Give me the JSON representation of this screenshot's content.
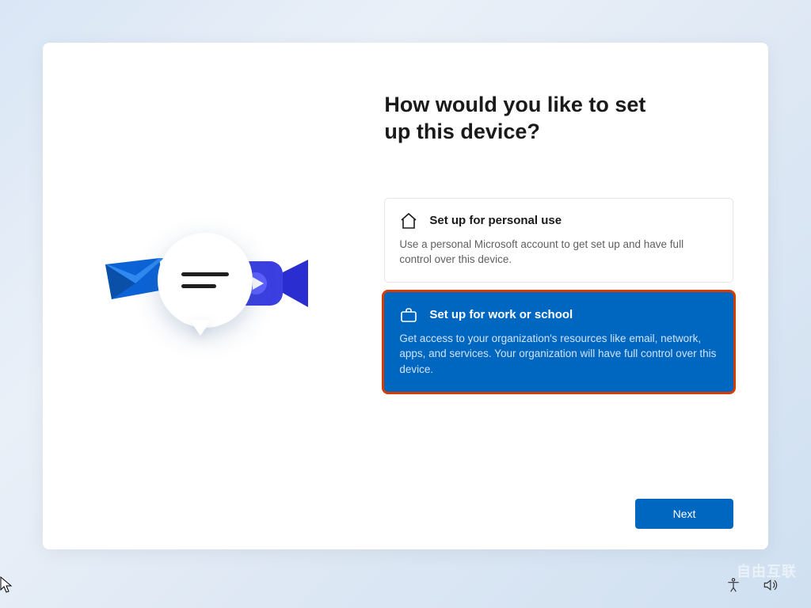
{
  "title": "How would you like to set up this device?",
  "options": [
    {
      "label": "Set up for personal use",
      "desc": "Use a personal Microsoft account to get set up and have full control over this device."
    },
    {
      "label": "Set up for work or school",
      "desc": "Get access to your organization's resources like email, network, apps, and services. Your organization will have full control over this device."
    }
  ],
  "footer": {
    "next_label": "Next"
  },
  "watermark": "自由互联"
}
